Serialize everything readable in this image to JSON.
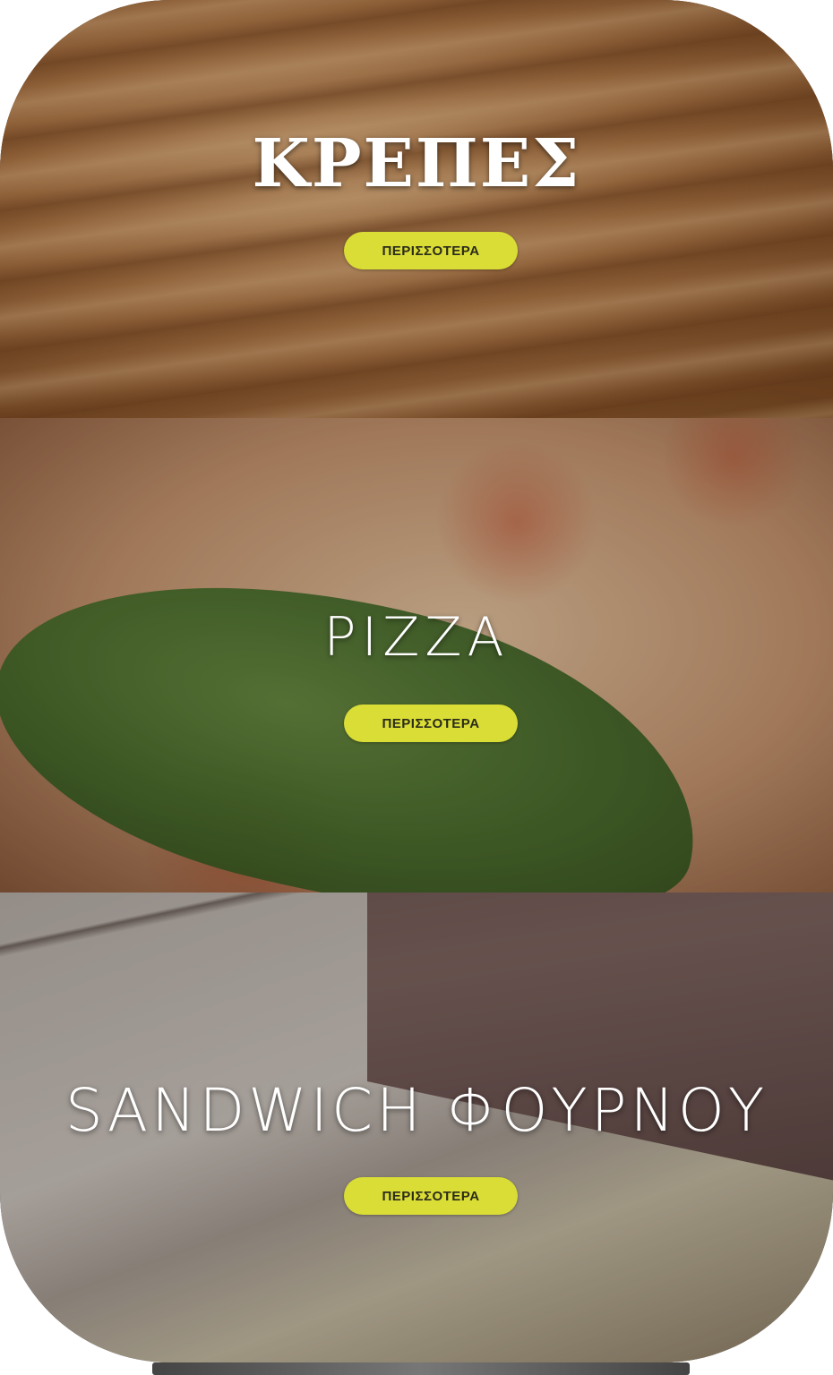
{
  "sections": [
    {
      "title": "ΚΡΕΠΕΣ",
      "button_label": "ΠΕΡΙΣΣΟΤΕΡΑ"
    },
    {
      "title": "PIZZA",
      "button_label": "ΠΕΡΙΣΣΟΤΕΡΑ"
    },
    {
      "title": "SANDWICH ΦΟΥΡΝΟΥ",
      "button_label": "ΠΕΡΙΣΣΟΤΕΡΑ"
    }
  ],
  "colors": {
    "button_bg": "#d9dd35",
    "title_text": "#ffffff"
  }
}
